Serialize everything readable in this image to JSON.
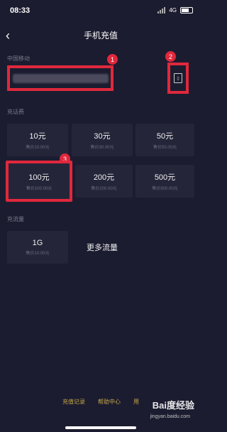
{
  "status": {
    "time": "08:33",
    "network": "4G"
  },
  "header": {
    "back_icon": "chevron-left-icon",
    "back_glyph": "‹",
    "title": "手机充值"
  },
  "operator": {
    "label": "中国移动",
    "phone_number_hidden": true
  },
  "badges": {
    "one": "1",
    "two": "2",
    "three": "3"
  },
  "recharge": {
    "label": "充话费",
    "items": [
      {
        "amount": "10元",
        "price": "售价10.00元"
      },
      {
        "amount": "30元",
        "price": "售价30.00元"
      },
      {
        "amount": "50元",
        "price": "售价50.00元"
      },
      {
        "amount": "100元",
        "price": "售价100.00元"
      },
      {
        "amount": "200元",
        "price": "售价200.00元"
      },
      {
        "amount": "500元",
        "price": "售价500.00元"
      }
    ]
  },
  "data_plan": {
    "label": "充流量",
    "item": {
      "amount": "1G",
      "price": "售价10.00元"
    },
    "more": "更多流量"
  },
  "footer": {
    "records": "充值记录",
    "help": "帮助中心",
    "use": "用"
  },
  "watermark": {
    "brand": "Bai度经验",
    "url": "jingyan.baidu.com"
  },
  "colors": {
    "background": "#1c1c30",
    "card": "#25253a",
    "highlight": "#e0283c",
    "link": "#c6a94a"
  }
}
